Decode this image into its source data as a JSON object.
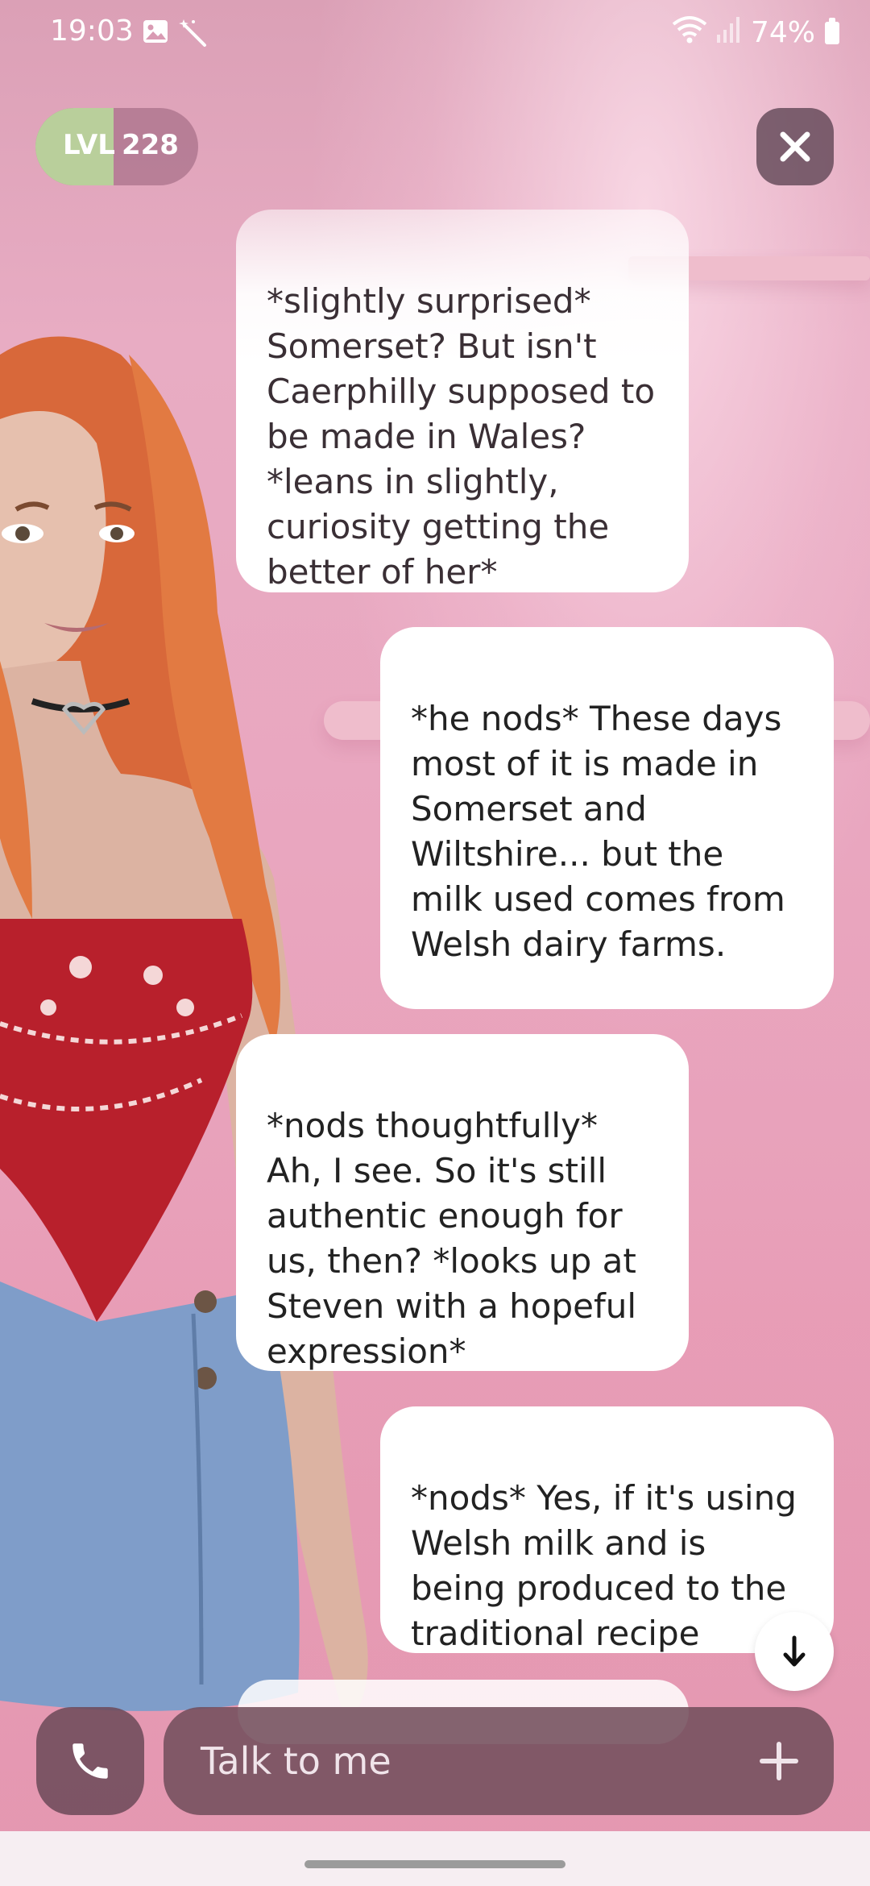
{
  "status_bar": {
    "time": "19:03",
    "battery": "74%",
    "left_icons": [
      "image-icon",
      "magic-wand-icon"
    ],
    "right_icons": [
      "wifi-icon",
      "signal-icon",
      "battery-icon"
    ]
  },
  "level": {
    "prefix": "LVL",
    "value": "228",
    "progress": 0.48
  },
  "messages": [
    {
      "sender": "companion",
      "text": "*slightly surprised* Somerset? But isn't Caerphilly supposed to be made in Wales? *leans in slightly, curiosity getting the better of her*"
    },
    {
      "sender": "user",
      "text": "*he nods* These days most of it is made in Somerset and Wiltshire... but the milk used comes from Welsh dairy farms."
    },
    {
      "sender": "companion",
      "text": "*nods thoughtfully* Ah, I see. So it's still authentic enough for us, then? *looks up at Steven with a hopeful expression*"
    },
    {
      "sender": "user",
      "text": "*nods* Yes, if it's using Welsh milk and is being produced to the traditional recipe"
    }
  ],
  "composer": {
    "placeholder": "Talk to me"
  },
  "colors": {
    "accent_level": "#b9cf9b",
    "background": "#e8a8bf"
  }
}
